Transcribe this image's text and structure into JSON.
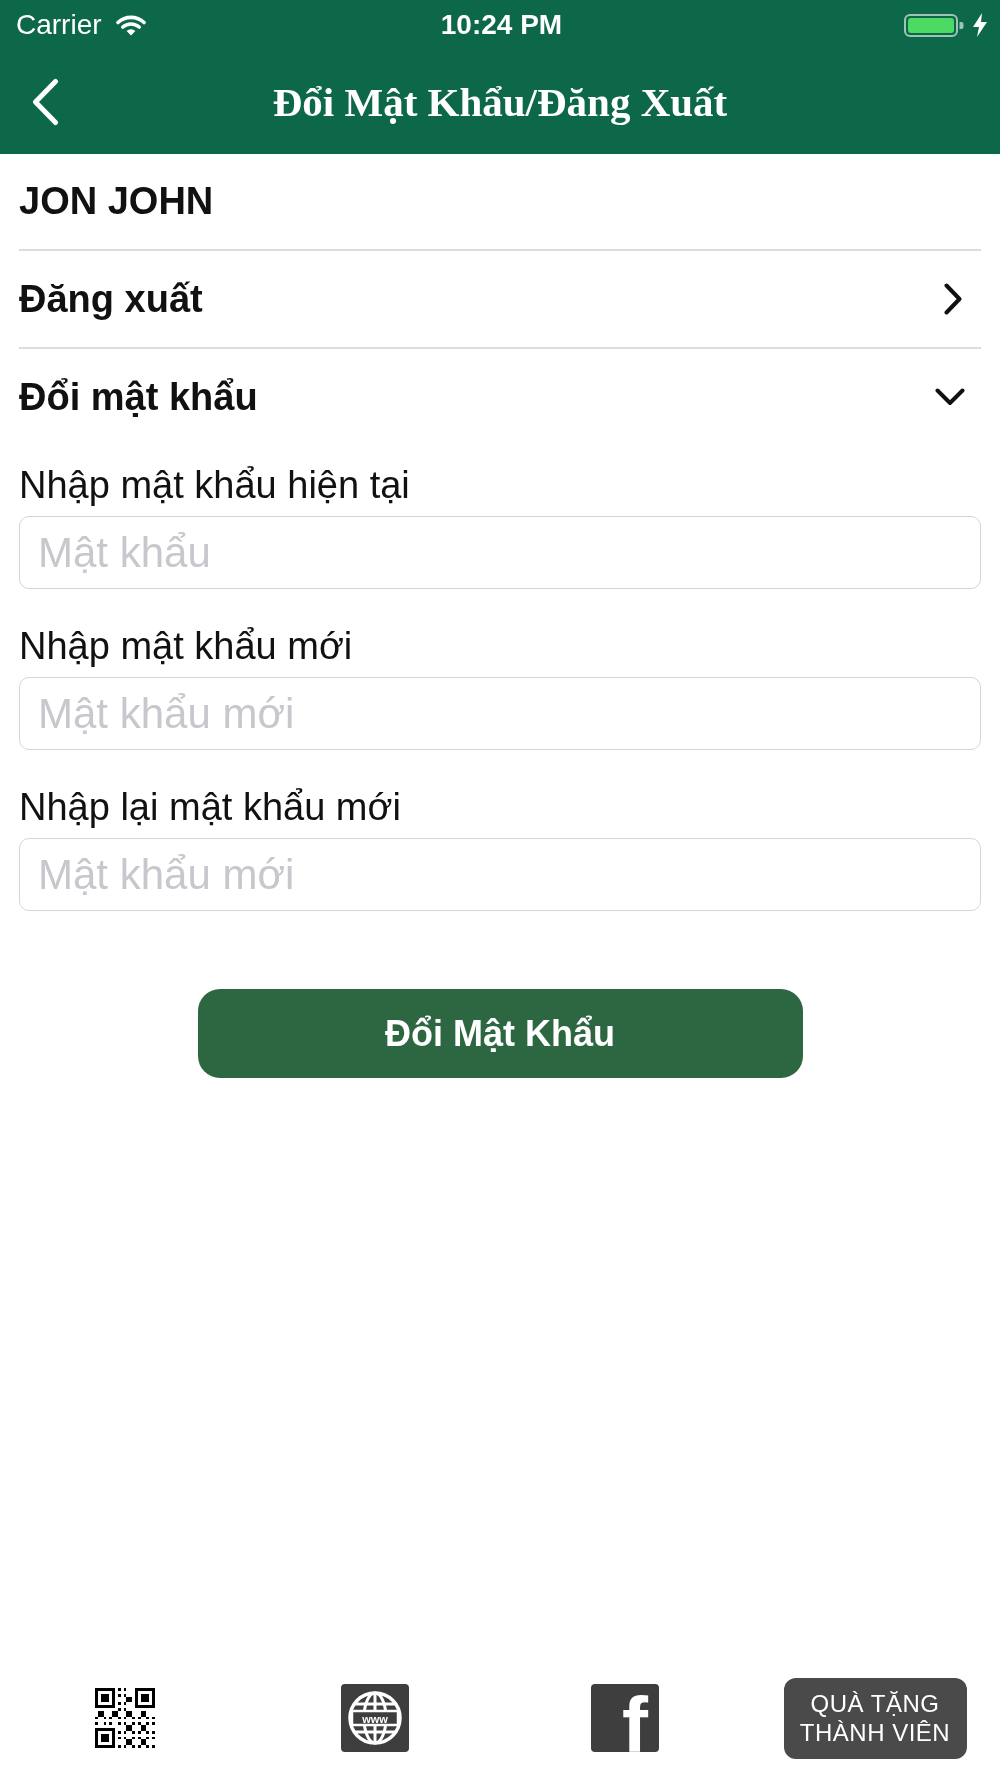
{
  "status_bar": {
    "carrier": "Carrier",
    "time": "10:24 PM"
  },
  "nav_bar": {
    "title": "Đổi Mật Khẩu/Đăng Xuất"
  },
  "account": {
    "name": "JON JOHN"
  },
  "menu": [
    {
      "label": "Đăng xuất",
      "expanded": false
    },
    {
      "label": "Đổi mật khẩu",
      "expanded": true
    }
  ],
  "password_form": {
    "fields": [
      {
        "label": "Nhập mật khẩu hiện tại",
        "placeholder": "Mật khẩu"
      },
      {
        "label": "Nhập mật khẩu mới",
        "placeholder": "Mật khẩu mới"
      },
      {
        "label": "Nhập lại mật khẩu mới",
        "placeholder": "Mật khẩu mới"
      }
    ],
    "submit": "Đổi Mật Khẩu"
  },
  "bottom_bar": [
    {
      "kind": "qr"
    },
    {
      "kind": "web",
      "text": "www"
    },
    {
      "kind": "social",
      "text": "f"
    },
    {
      "kind": "gift",
      "label": "QUÀ TẶNG THÀNH VIÊN"
    }
  ]
}
